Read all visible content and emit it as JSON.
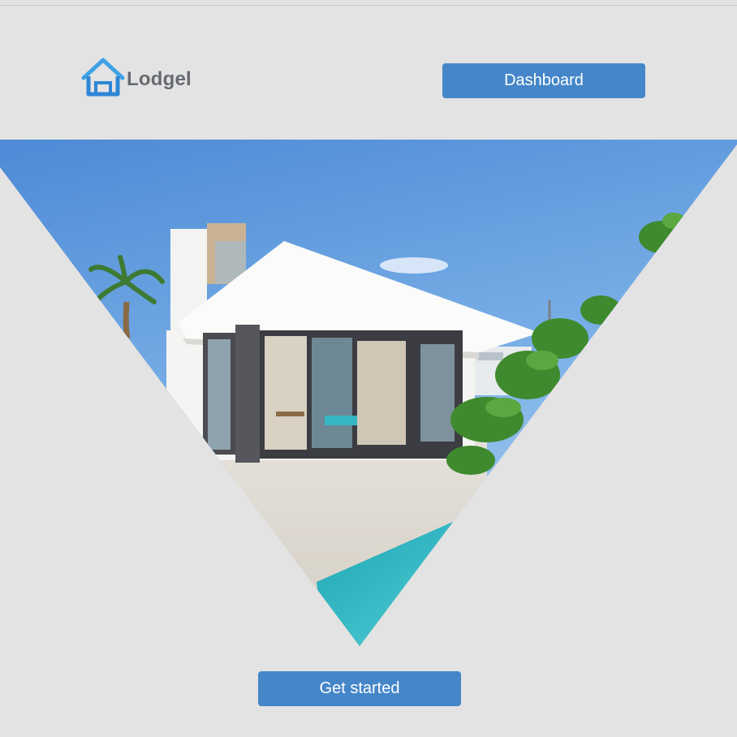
{
  "header": {
    "logo_text": "Lodgel",
    "logo_icon": "house-icon",
    "dashboard_label": "Dashboard"
  },
  "hero": {
    "image": "modern-villa-with-pool"
  },
  "cta": {
    "get_started_label": "Get started"
  },
  "colors": {
    "background": "#e3e3e3",
    "button": "#4586c9",
    "logo_blue": "#3a8ad9",
    "logo_text": "#666a70"
  }
}
